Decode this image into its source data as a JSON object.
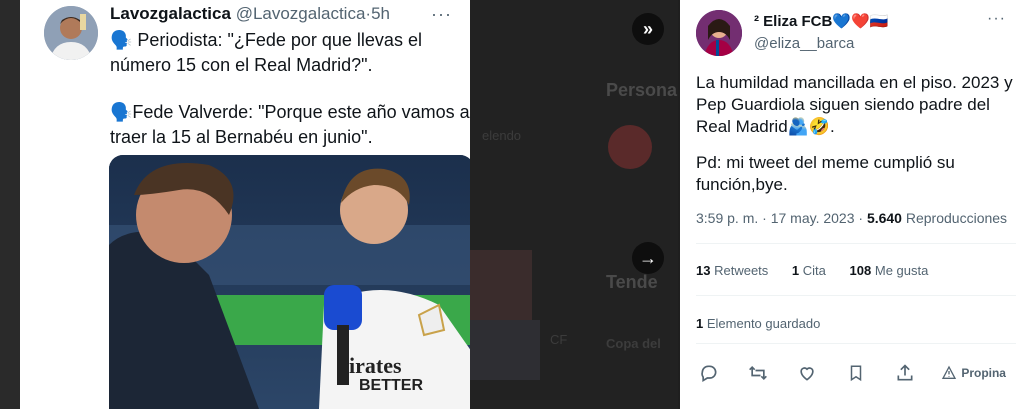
{
  "background": {
    "heading_personas": "Persona",
    "text_relendo": "elendo",
    "heading_tendencias": "Tende",
    "trend_copa": "Copa del",
    "trend_cf": "CF"
  },
  "left_tweet": {
    "author_name": "Lavozgalactica",
    "author_handle": "@Lavozgalactica",
    "time": "5h",
    "line1": "🗣️ Periodista: \"¿Fede por que llevas el número 15 con el Real Madrid?\".",
    "line2": "🗣️Fede Valverde: \"Porque este año vamos a traer la 15 al Bernabéu en junio\".",
    "photo_jersey_text": "irates",
    "photo_jersey_text2": "BETTER"
  },
  "right_tweet": {
    "author_name": "² Eliza FCB💙❤️🇷🇺",
    "author_handle": "@eliza__barca",
    "paragraph1": "La humildad mancillada en el piso. 2023 y Pep Guardiola siguen siendo padre del Real Madrid🫂🤣.",
    "paragraph2": "Pd: mi tweet del meme cumplió su función,bye.",
    "timestamp": "3:59 p. m. · 17 may. 2023 · ",
    "views_count": "5.640",
    "views_label": " Reproducciones",
    "retweets_count": "13",
    "retweets_label": "Retweets",
    "quotes_count": "1",
    "quotes_label": "Cita",
    "likes_count": "108",
    "likes_label": "Me gusta",
    "saved_count": "1",
    "saved_label": "Elemento guardado",
    "share_label": "Propina"
  },
  "icons": {
    "expand": "double-chevron-right-icon",
    "next": "arrow-right-icon",
    "reply": "reply-icon",
    "retweet": "retweet-icon",
    "like": "heart-icon",
    "bookmark": "bookmark-icon",
    "share": "share-icon",
    "tip": "tip-icon"
  }
}
